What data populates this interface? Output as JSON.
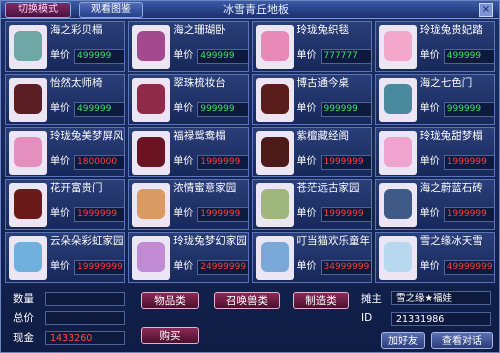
{
  "header": {
    "mode_switch": "切换模式",
    "view_catalog": "观看图鉴",
    "title": "冰雪青丘地板",
    "close": "×"
  },
  "unit_label": "单价",
  "items": [
    {
      "name": "海之彩贝榻",
      "price": "499999",
      "price_color": "green",
      "thumb_color": "#6fa6a6"
    },
    {
      "name": "海之珊瑚卧",
      "price": "499999",
      "price_color": "green",
      "thumb_color": "#a34a8e"
    },
    {
      "name": "玲珑兔织毯",
      "price": "777777",
      "price_color": "green",
      "thumb_color": "#e889b7"
    },
    {
      "name": "玲珑兔贵妃踏",
      "price": "499999",
      "price_color": "green",
      "thumb_color": "#f2a7cb"
    },
    {
      "name": "怡然太师椅",
      "price": "499999",
      "price_color": "green",
      "thumb_color": "#5a1e24"
    },
    {
      "name": "翠珠梳妆台",
      "price": "999999",
      "price_color": "green",
      "thumb_color": "#8f2a48"
    },
    {
      "name": "博古通今桌",
      "price": "999999",
      "price_color": "green",
      "thumb_color": "#5b1c1c"
    },
    {
      "name": "海之七色门",
      "price": "999999",
      "price_color": "green",
      "thumb_color": "#4a8a9e"
    },
    {
      "name": "玲珑兔美梦屏风",
      "price": "1800000",
      "price_color": "red",
      "thumb_color": "#e58fbf"
    },
    {
      "name": "福禄鸳鸯榻",
      "price": "1999999",
      "price_color": "red",
      "thumb_color": "#6b1322"
    },
    {
      "name": "紫檀藏经阁",
      "price": "1999999",
      "price_color": "red",
      "thumb_color": "#4d1a1a"
    },
    {
      "name": "玲珑兔甜梦榻",
      "price": "1999999",
      "price_color": "red",
      "thumb_color": "#f0a3cf"
    },
    {
      "name": "花开富贵门",
      "price": "1999999",
      "price_color": "red",
      "thumb_color": "#6b1a1a"
    },
    {
      "name": "浓情蜜意家园",
      "price": "1999999",
      "price_color": "red",
      "thumb_color": "#d99a64"
    },
    {
      "name": "苍茫远古家园",
      "price": "1999999",
      "price_color": "red",
      "thumb_color": "#9fb77d"
    },
    {
      "name": "海之蔚蓝石砖",
      "price": "1999999",
      "price_color": "red",
      "thumb_color": "#3f5a86"
    },
    {
      "name": "云朵朵彩虹家园",
      "price": "19999999",
      "price_color": "red",
      "thumb_color": "#6fb0dc"
    },
    {
      "name": "玲珑兔梦幻家园",
      "price": "24999999",
      "price_color": "red",
      "thumb_color": "#c18ad4"
    },
    {
      "name": "叮当猫欢乐童年地板",
      "price": "34999999",
      "price_color": "red",
      "thumb_color": "#7aa8d8"
    },
    {
      "name": "雪之缘冰天雪",
      "price": "49999999",
      "price_color": "red",
      "thumb_color": "#b6d9ef"
    }
  ],
  "footer": {
    "quantity_label": "数量",
    "quantity_value": "",
    "total_label": "总价",
    "total_value": "",
    "cash_label": "现金",
    "cash_value": "1433260",
    "btn_goods": "物品类",
    "btn_summon": "召唤兽类",
    "btn_craft": "制造类",
    "btn_buy": "购买",
    "owner_label": "摊主",
    "owner_value": "雪之缘★福娃",
    "id_label": "ID",
    "id_value": "21331986",
    "btn_friend": "加好友",
    "btn_chat": "查看对话"
  }
}
